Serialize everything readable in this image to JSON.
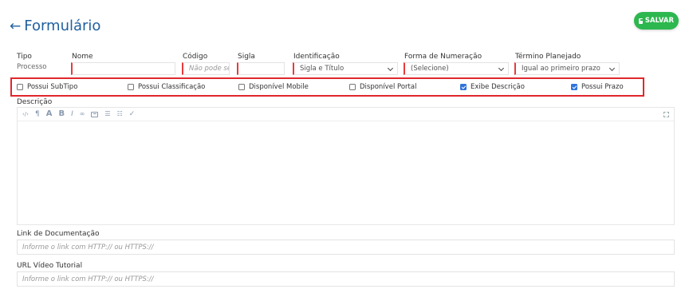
{
  "header": {
    "back_arrow": "←",
    "title": "Formulário",
    "save_label": "SALVAR",
    "save_color": "#2db74f"
  },
  "fields": {
    "tipo": {
      "label": "Tipo",
      "value": "Processo"
    },
    "nome": {
      "label": "Nome",
      "value": ""
    },
    "codigo": {
      "label": "Código",
      "placeholder": "Não pode ser"
    },
    "sigla": {
      "label": "Sigla",
      "value": ""
    },
    "identificacao": {
      "label": "Identificação",
      "value": "Sigla e Título"
    },
    "forma_numeracao": {
      "label": "Forma de Numeração",
      "value": "(Selecione)"
    },
    "termino_planejado": {
      "label": "Término Planejado",
      "value": "Igual ao primeiro prazo"
    }
  },
  "checkboxes": [
    {
      "label": "Possui SubTipo",
      "checked": false
    },
    {
      "label": "Possui Classificação",
      "checked": false
    },
    {
      "label": "Disponível Mobile",
      "checked": false
    },
    {
      "label": "Disponível Portal",
      "checked": false
    },
    {
      "label": "Exibe Descrição",
      "checked": true
    },
    {
      "label": "Possui Prazo",
      "checked": true
    }
  ],
  "descricao": {
    "label": "Descrição",
    "toolbar_icons": [
      "code-icon",
      "paragraph-icon",
      "font-size-icon",
      "bold-icon",
      "italic-icon",
      "link-icon",
      "image-icon",
      "bullet-list-icon",
      "numbered-list-icon",
      "clear-format-icon",
      "fullscreen-icon"
    ],
    "toolbar_glyphs": {
      "code": "‹/›",
      "paragraph": "¶",
      "font_size": "A",
      "bold": "B",
      "italic": "I",
      "link": "🔗",
      "bullets": "☰",
      "numbers": "☷",
      "clear": "✓"
    }
  },
  "link_documentacao": {
    "label": "Link de Documentação",
    "placeholder": "Informe o link com HTTP:// ou HTTPS://"
  },
  "url_video": {
    "label": "URL Vídeo Tutorial",
    "placeholder": "Informe o link com HTTP:// ou HTTPS://"
  },
  "colors": {
    "accent": "#1f5f9e",
    "required_border": "#e53b3b",
    "highlight_box": "#e0282d",
    "checkbox_checked": "#2f74d9"
  }
}
